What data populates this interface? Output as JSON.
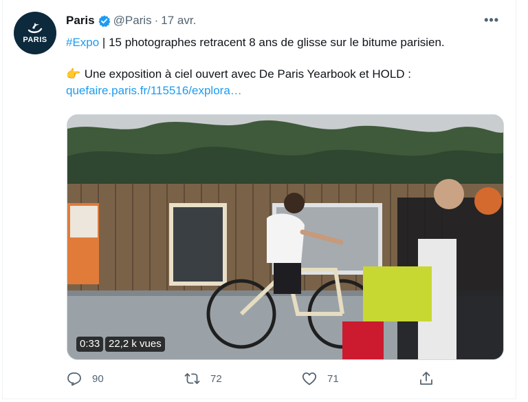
{
  "author": {
    "name": "Paris",
    "handle": "@Paris",
    "separator": "·",
    "time": "17 avr.",
    "avatar_text": "PARIS"
  },
  "tweet": {
    "hashtag": "#Expo",
    "line1_rest": " | 15 photographes retracent 8 ans de glisse sur le bitume parisien.",
    "emoji": "👉",
    "line2": " Une exposition à ciel ouvert avec De Paris Yearbook et HOLD :",
    "link": "quefaire.paris.fr/115516/explora…"
  },
  "video": {
    "duration": "0:33",
    "views": "22,2 k vues"
  },
  "actions": {
    "replies": "90",
    "retweets": "72",
    "likes": "71"
  },
  "icons": {
    "more": "more-icon",
    "verified": "verified-badge-icon",
    "reply": "reply-icon",
    "retweet": "retweet-icon",
    "like": "heart-icon",
    "share": "share-icon"
  },
  "colors": {
    "accent": "#1d9bf0",
    "secondary_text": "#536471",
    "avatar_bg": "#0d2a3d"
  }
}
